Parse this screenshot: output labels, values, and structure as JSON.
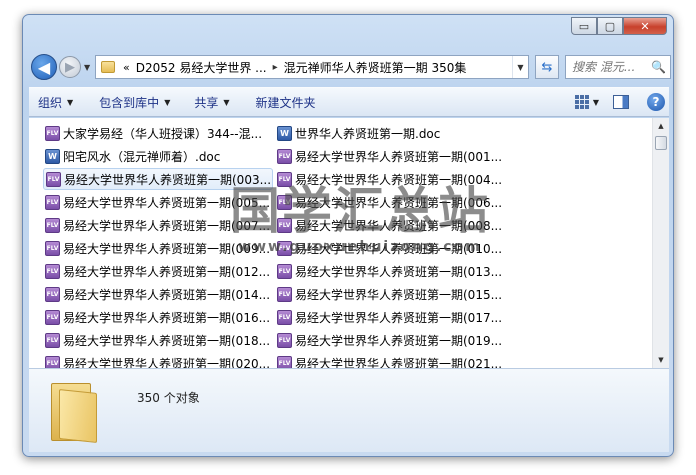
{
  "window": {
    "controls": {
      "minimize": "▭",
      "maximize": "▢",
      "close": "✕"
    }
  },
  "nav": {
    "back_icon": "◀",
    "forward_icon": "▶",
    "recent_icon": "▼"
  },
  "address": {
    "overflow": "«",
    "segments": [
      "D2052 易经大学世界 ...",
      "混元禅师华人养贤班第一期 350集"
    ],
    "separator": "▸",
    "dropdown": "▼"
  },
  "refresh_icon": "⇆",
  "search": {
    "placeholder": "搜索 混元...",
    "icon": "🔍"
  },
  "toolbar": {
    "organize": "组织",
    "include_in_library": "包含到库中",
    "share": "共享",
    "new_folder": "新建文件夹",
    "caret": "▼",
    "help": "?"
  },
  "files": [
    {
      "name": "大家学易经（华人班授课）344--混...",
      "type": "video",
      "col": 0,
      "row": 0,
      "selected": false
    },
    {
      "name": "世界华人养贤班第一期.doc",
      "type": "doc",
      "col": 1,
      "row": 0,
      "selected": false
    },
    {
      "name": "阳宅风水（混元禅师着）.doc",
      "type": "doc",
      "col": 0,
      "row": 1,
      "selected": false
    },
    {
      "name": "易经大学世界华人养贤班第一期(001...",
      "type": "video",
      "col": 1,
      "row": 1,
      "selected": false
    },
    {
      "name": "易经大学世界华人养贤班第一期(003...",
      "type": "video",
      "col": 0,
      "row": 2,
      "selected": true
    },
    {
      "name": "易经大学世界华人养贤班第一期(004...",
      "type": "video",
      "col": 1,
      "row": 2,
      "selected": false
    },
    {
      "name": "易经大学世界华人养贤班第一期(005...",
      "type": "video",
      "col": 0,
      "row": 3,
      "selected": false
    },
    {
      "name": "易经大学世界华人养贤班第一期(006...",
      "type": "video",
      "col": 1,
      "row": 3,
      "selected": false
    },
    {
      "name": "易经大学世界华人养贤班第一期(007...",
      "type": "video",
      "col": 0,
      "row": 4,
      "selected": false
    },
    {
      "name": "易经大学世界华人养贤班第一期(008...",
      "type": "video",
      "col": 1,
      "row": 4,
      "selected": false
    },
    {
      "name": "易经大学世界华人养贤班第一期(009...",
      "type": "video",
      "col": 0,
      "row": 5,
      "selected": false
    },
    {
      "name": "易经大学世界华人养贤班第一期(010...",
      "type": "video",
      "col": 1,
      "row": 5,
      "selected": false
    },
    {
      "name": "易经大学世界华人养贤班第一期(012...",
      "type": "video",
      "col": 0,
      "row": 6,
      "selected": false
    },
    {
      "name": "易经大学世界华人养贤班第一期(013...",
      "type": "video",
      "col": 1,
      "row": 6,
      "selected": false
    },
    {
      "name": "易经大学世界华人养贤班第一期(014...",
      "type": "video",
      "col": 0,
      "row": 7,
      "selected": false
    },
    {
      "name": "易经大学世界华人养贤班第一期(015...",
      "type": "video",
      "col": 1,
      "row": 7,
      "selected": false
    },
    {
      "name": "易经大学世界华人养贤班第一期(016...",
      "type": "video",
      "col": 0,
      "row": 8,
      "selected": false
    },
    {
      "name": "易经大学世界华人养贤班第一期(017...",
      "type": "video",
      "col": 1,
      "row": 8,
      "selected": false
    },
    {
      "name": "易经大学世界华人养贤班第一期(018...",
      "type": "video",
      "col": 0,
      "row": 9,
      "selected": false
    },
    {
      "name": "易经大学世界华人养贤班第一期(019...",
      "type": "video",
      "col": 1,
      "row": 9,
      "selected": false
    },
    {
      "name": "易经大学世界华人养贤班第一期(020...",
      "type": "video",
      "col": 0,
      "row": 10,
      "selected": false
    },
    {
      "name": "易经大学世界华人养贤班第一期(021...",
      "type": "video",
      "col": 1,
      "row": 10,
      "selected": false
    }
  ],
  "file_icon_labels": {
    "video": "FLV",
    "doc": "W"
  },
  "scrollbar": {
    "up": "▲",
    "down": "▼"
  },
  "status": {
    "count_text": "350 个对象"
  },
  "watermark": {
    "title": "国学汇总站",
    "url": "www.guoxuehuizong.com"
  }
}
